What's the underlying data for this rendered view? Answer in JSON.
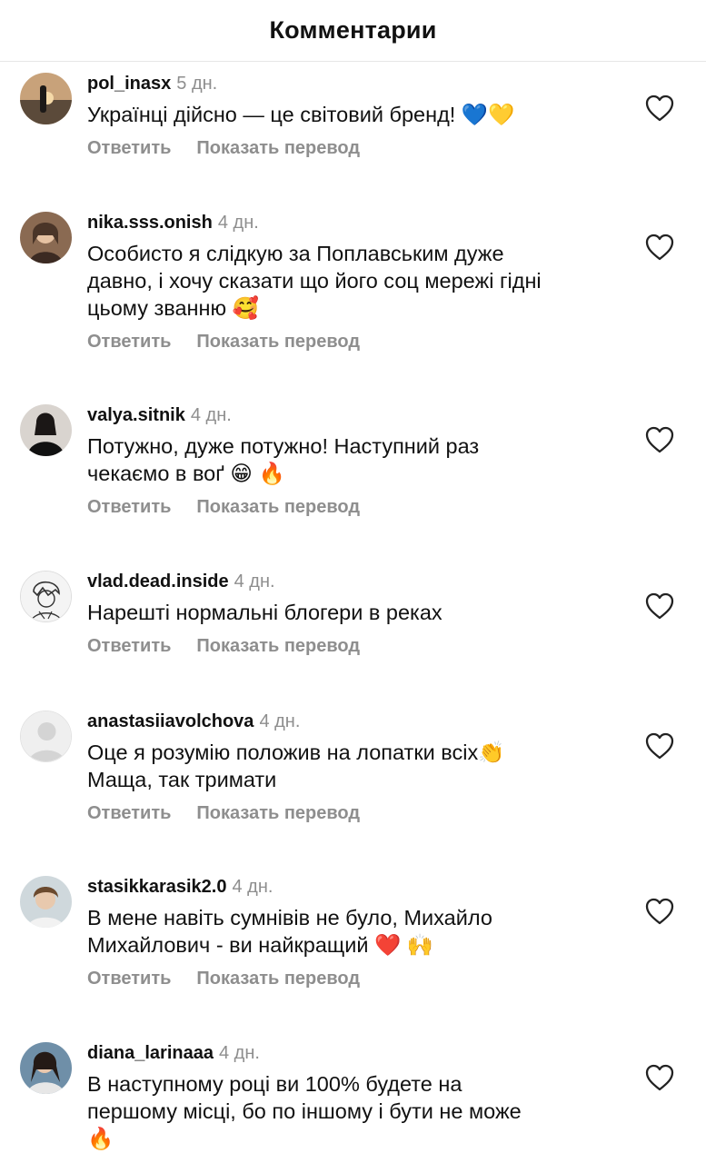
{
  "header": {
    "title": "Комментарии"
  },
  "actions": {
    "reply": "Ответить",
    "translate": "Показать перевод"
  },
  "icons": {
    "like": "heart-outline-icon"
  },
  "comments": [
    {
      "username": "pol_inasx",
      "time": "5 дн.",
      "text": "Українці дійсно — це світовий бренд! 💙💛"
    },
    {
      "username": "nika.sss.onish",
      "time": "4 дн.",
      "text": "Особисто я слідкую за Поплавським дуже\nдавно, і хочу сказати що його соц мережі гідні\nцьому званню 🥰"
    },
    {
      "username": "valya.sitnik",
      "time": "4 дн.",
      "text": "Потужно, дуже потужно! Наступний раз\nчекаємо в воґ 😁 🔥"
    },
    {
      "username": "vlad.dead.inside",
      "time": "4 дн.",
      "text": "Нарешті нормальні блогери в реках"
    },
    {
      "username": "anastasiiavolchova",
      "time": "4 дн.",
      "text": "Оце я розумію положив на лопатки всіх👏\nМаща, так тримати"
    },
    {
      "username": "stasikkarasik2.0",
      "time": "4 дн.",
      "text": "В мене навіть сумнівів не було, Михайло\nМихайлович - ви найкращий ❤️ 🙌"
    },
    {
      "username": "diana_larinaaa",
      "time": "4 дн.",
      "text": "В наступному році ви 100% будете на\nпершому місці, бо по іншому і бути не може\n🔥"
    }
  ]
}
